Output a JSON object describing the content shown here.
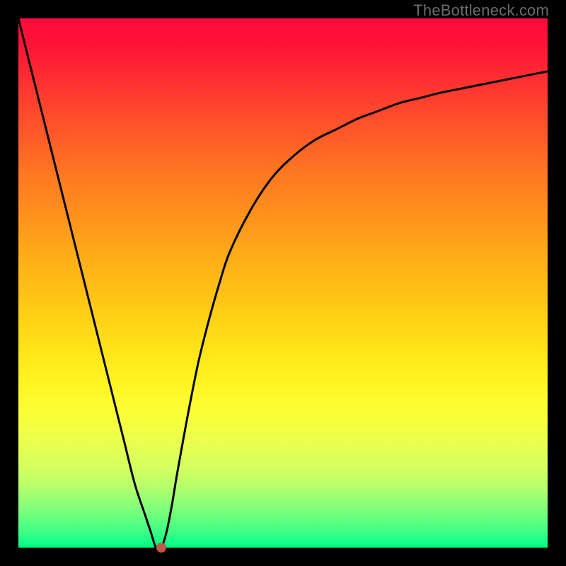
{
  "watermark": "TheBottleneck.com",
  "colors": {
    "frame": "#000000",
    "curve": "#000000",
    "point": "#c05a4a"
  },
  "chart_data": {
    "type": "line",
    "title": "",
    "xlabel": "",
    "ylabel": "",
    "xlim": [
      0,
      100
    ],
    "ylim": [
      0,
      100
    ],
    "series": [
      {
        "name": "bottleneck-curve",
        "x": [
          0,
          2,
          4,
          6,
          8,
          10,
          12,
          14,
          16,
          18,
          20,
          22,
          24,
          25,
          26,
          27,
          28,
          29,
          30,
          32,
          34,
          36,
          38,
          40,
          44,
          48,
          52,
          56,
          60,
          64,
          68,
          72,
          76,
          80,
          84,
          88,
          92,
          96,
          100
        ],
        "values": [
          100,
          92,
          84,
          76,
          68,
          60,
          52,
          44,
          36,
          28,
          20,
          12,
          6,
          3,
          0,
          0,
          3,
          8,
          14,
          25,
          35,
          43,
          50,
          56,
          64,
          70,
          74,
          77,
          79,
          81,
          82.5,
          84,
          85,
          86,
          86.8,
          87.6,
          88.4,
          89.2,
          90
        ]
      }
    ],
    "annotations": [
      {
        "name": "min-point",
        "x": 27,
        "y": 0
      }
    ]
  }
}
